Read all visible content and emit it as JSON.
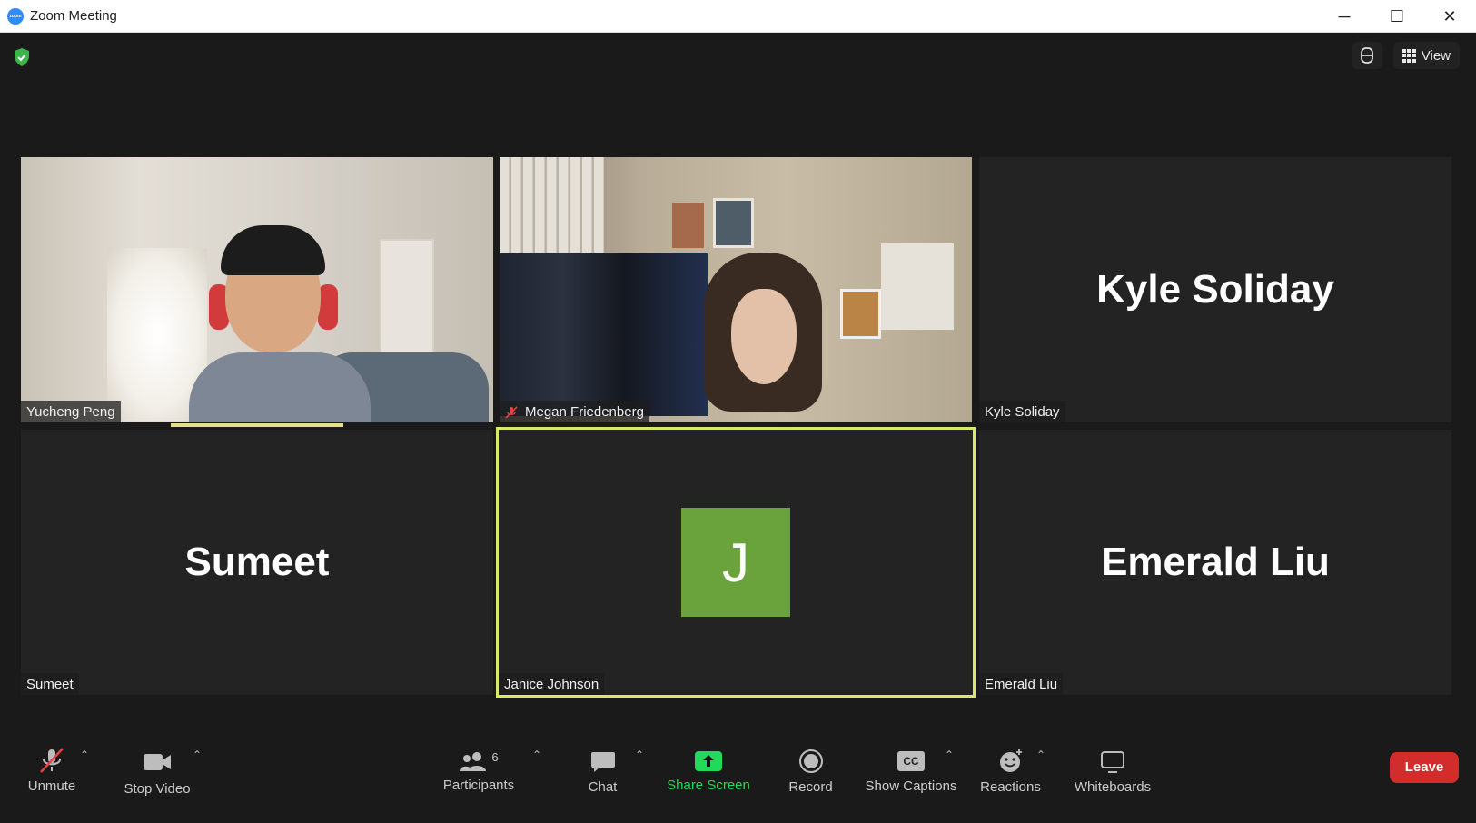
{
  "window": {
    "title": "Zoom Meeting",
    "logo_text": "zoom",
    "controls": {
      "minimize": "─",
      "maximize": "☐",
      "close": "✕"
    }
  },
  "top_bar": {
    "view_label": "View"
  },
  "tiles": [
    {
      "name": "Yucheng Peng",
      "type": "video",
      "muted": false,
      "speaking": true
    },
    {
      "name": "Megan Friedenberg",
      "type": "video",
      "muted": true
    },
    {
      "name": "Kyle Soliday",
      "type": "name",
      "display_name": "Kyle Soliday"
    },
    {
      "name": "Sumeet",
      "type": "name",
      "display_name": "Sumeet"
    },
    {
      "name": "Janice Johnson",
      "type": "avatar",
      "avatar_letter": "J",
      "active": true,
      "avatar_color": "#6aa33c"
    },
    {
      "name": "Emerald Liu",
      "type": "name",
      "display_name": "Emerald Liu"
    }
  ],
  "toolbar": {
    "unmute": "Unmute",
    "stop_video": "Stop Video",
    "participants": "Participants",
    "participants_count": "6",
    "chat": "Chat",
    "share_screen": "Share Screen",
    "record": "Record",
    "show_captions": "Show Captions",
    "captions_icon_text": "CC",
    "reactions": "Reactions",
    "whiteboards": "Whiteboards",
    "leave": "Leave"
  },
  "colors": {
    "share_green": "#23d959",
    "leave_red": "#d32c2c",
    "active_border": "#d9e86a",
    "shield_green": "#3bb54a"
  }
}
